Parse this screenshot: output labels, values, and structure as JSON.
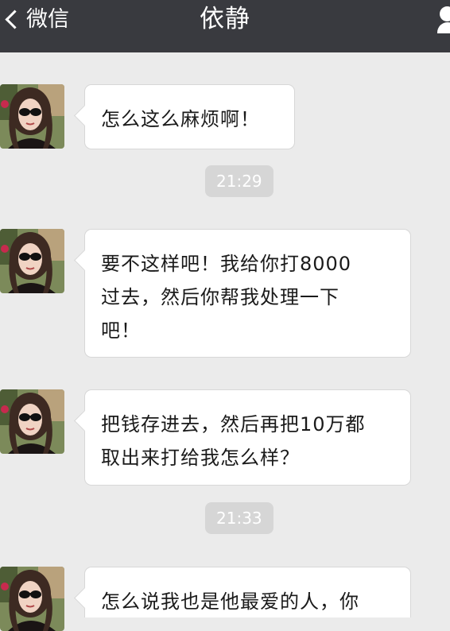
{
  "header": {
    "back_label": "微信",
    "title": "依静"
  },
  "messages": [
    {
      "text": "怎么这么麻烦啊！"
    },
    {
      "text": "要不这样吧！我给你打8000\n过去，然后你帮我处理一下\n吧！"
    },
    {
      "text": "把钱存进去，然后再把10万都\n取出来打给我怎么样？"
    },
    {
      "text": "怎么说我也是他最爱的人，你"
    }
  ],
  "timestamps": [
    "21:29",
    "21:33"
  ],
  "colors": {
    "header_bg": "#393a3f",
    "chat_bg": "#ebebeb",
    "bubble_bg": "#ffffff",
    "time_pill_bg": "#d6d6d6"
  },
  "icons": [
    "back-chevron-icon",
    "person-icon"
  ]
}
